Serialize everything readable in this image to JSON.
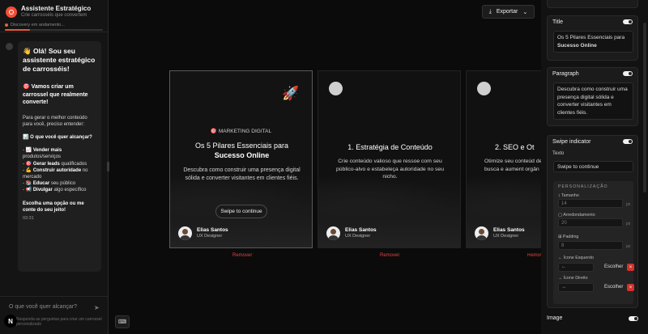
{
  "sidebar": {
    "title": "Assistente Estratégico",
    "subtitle": "Crie carrosséis que convertem",
    "status": "Discovery em andamento...",
    "progress": 0.26,
    "message": {
      "greeting": "👋 Olá! Sou seu assistente estratégico de carrosséis!",
      "intro": "🎯 Vamos criar um carrossel que realmente converte!",
      "para": "Para gerar o melhor conteúdo para você, preciso entender:",
      "question": "📊 O que você quer alcançar?",
      "options": [
        {
          "prefix": "- 📈 ",
          "bold": "Vender mais",
          "rest": " produtos/serviços"
        },
        {
          "prefix": "- 🎯 ",
          "bold": "Gerar leads",
          "rest": " qualificados"
        },
        {
          "prefix": "- 💪 ",
          "bold": "Construir autoridade",
          "rest": " no mercado"
        },
        {
          "prefix": "- 📚 ",
          "bold": "Educar",
          "rest": " seu público"
        },
        {
          "prefix": "- 📢 ",
          "bold": "Divulgar",
          "rest": " algo específico"
        }
      ],
      "closing": "Escolha uma opção ou me conte do seu jeito!",
      "time": "03:31"
    },
    "input_placeholder": "O que você quer alcançar?",
    "hint": "Responda as perguntas para criar um carrossel personalizado"
  },
  "toolbar": {
    "export_label": "Exportar"
  },
  "slides": [
    {
      "tag": "🎯 MARKETING DIGITAL",
      "title": "Os 5 Pilares Essenciais para",
      "title_bold": "Sucesso Online",
      "desc": "Descubra como construir uma presença digital sólida e converter visitantes em clientes fiéis.",
      "swipe": "Swipe to continue",
      "author": "Elias Santos",
      "role": "UX Designer",
      "remove": "Remover"
    },
    {
      "title": "1. Estratégia de Conteúdo",
      "desc": "Crie conteúdo valioso que ressoe com seu público-alvo e estabeleça autoridade no seu nicho.",
      "author": "Elias Santos",
      "role": "UX Designer",
      "remove": "Remover"
    },
    {
      "title": "2. SEO e Ot",
      "desc": "Otimize seu conteúd de busca e aument orgân",
      "author": "Elias Santos",
      "role": "UX Designer",
      "remove": "Remov"
    }
  ],
  "panel": {
    "title_section": {
      "label": "Title",
      "value_line1": "Os 5 Pilares Essenciais para",
      "value_line2": "Sucesso Online"
    },
    "paragraph_section": {
      "label": "Paragraph",
      "value": "Descubra como construir uma presença digital sólida e converter visitantes em clientes fiéis."
    },
    "swipe_section": {
      "label": "Swipe indicator",
      "text_label": "Texto",
      "text_value": "Swipe to continue",
      "personalization": "PERSONALIZAÇÃO",
      "size_label": "Tamanho",
      "size_value": "14",
      "radius_label": "Arredondamento",
      "radius_value": "20",
      "padding_label": "Padding",
      "padding_value": "8",
      "unit": "px",
      "left_icon_label": "Ícone Esquerdo",
      "left_icon_value": "←",
      "right_icon_label": "Ícone Direito",
      "right_icon_value": "→",
      "choose": "Escolher"
    },
    "image_label": "Image"
  },
  "colors": {
    "accent": "#f04e36",
    "remove": "#e0453a",
    "bg": "#0b0b0c"
  }
}
